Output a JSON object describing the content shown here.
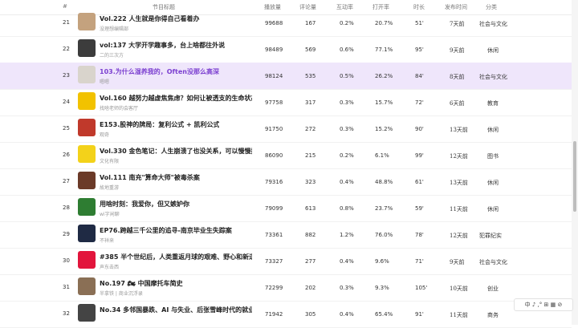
{
  "header": {
    "rank": "#",
    "title": "节目标题",
    "plays": "播放量",
    "comments": "评论量",
    "interaction": "互动率",
    "open_rate": "打开率",
    "duration": "时长",
    "published": "发布时间",
    "category": "分类"
  },
  "rows": [
    {
      "rank": "21",
      "title": "Vol.222 人生就是你得自己看着办",
      "author": "没理想编辑部",
      "plays": "99688",
      "comments": "167",
      "interaction": "0.2%",
      "open_rate": "20.7%",
      "duration": "51'",
      "published": "7天前",
      "category": "社会与文化",
      "thumb_color": "#c4a27e"
    },
    {
      "rank": "22",
      "title": "vol:137 大学开学趣事多，台上啥都往外说",
      "author": "二的三次方",
      "plays": "98489",
      "comments": "569",
      "interaction": "0.6%",
      "open_rate": "77.1%",
      "duration": "95'",
      "published": "9天前",
      "category": "休闲",
      "thumb_color": "#3c3c3c"
    },
    {
      "rank": "23",
      "title": "103.为什么湿养我的，Often没那么高深",
      "author": "嗯嗯",
      "plays": "98124",
      "comments": "535",
      "interaction": "0.5%",
      "open_rate": "26.2%",
      "duration": "84'",
      "published": "8天前",
      "category": "社会与文化",
      "thumb_color": "#d9d4cc"
    },
    {
      "rank": "24",
      "title": "Vol.160 越努力越虚焦焦虑？如何让被透支的生命状态...",
      "author": "找啥老师的会客厅",
      "plays": "97758",
      "comments": "317",
      "interaction": "0.3%",
      "open_rate": "15.7%",
      "duration": "72'",
      "published": "6天前",
      "category": "教育",
      "thumb_color": "#f2c200"
    },
    {
      "rank": "25",
      "title": "E153.股神的牌局：复利公式 + 凯利公式",
      "author": "观奇",
      "plays": "91750",
      "comments": "272",
      "interaction": "0.3%",
      "open_rate": "15.2%",
      "duration": "90'",
      "published": "13天前",
      "category": "休闲",
      "thumb_color": "#c0392b"
    },
    {
      "rank": "26",
      "title": "Vol.330 金色笔记：人生崩溃了也没关系，可以慢慢拼...",
      "author": "文化有限",
      "plays": "86090",
      "comments": "215",
      "interaction": "0.2%",
      "open_rate": "6.1%",
      "duration": "99'",
      "published": "12天前",
      "category": "图书",
      "thumb_color": "#f3d21a"
    },
    {
      "rank": "27",
      "title": "Vol.111 南充\"算命大师\"被毒杀案",
      "author": "故地重游",
      "plays": "79316",
      "comments": "323",
      "interaction": "0.4%",
      "open_rate": "48.8%",
      "duration": "61'",
      "published": "13天前",
      "category": "休闲",
      "thumb_color": "#6b3a28"
    },
    {
      "rank": "28",
      "title": "用啥时刻：我爱你，但又嫉妒你",
      "author": "wi字闲聊",
      "plays": "79099",
      "comments": "613",
      "interaction": "0.8%",
      "open_rate": "23.7%",
      "duration": "59'",
      "published": "11天前",
      "category": "休闲",
      "thumb_color": "#2e7d32"
    },
    {
      "rank": "29",
      "title": "EP76.跨越三千公里的追寻-南京毕业生失踪案",
      "author": "不祥来",
      "plays": "73361",
      "comments": "882",
      "interaction": "1.2%",
      "open_rate": "76.0%",
      "duration": "78'",
      "published": "12天前",
      "category": "犯罪纪实",
      "thumb_color": "#1f2a44"
    },
    {
      "rank": "30",
      "title": "#385 半个世纪后，人类重返月球的艰难、野心和新逻辑",
      "author": "声东击西",
      "plays": "73327",
      "comments": "277",
      "interaction": "0.4%",
      "open_rate": "9.6%",
      "duration": "71'",
      "published": "9天前",
      "category": "社会与文化",
      "thumb_color": "#e2153c"
    },
    {
      "rank": "31",
      "title": "No.197 🏍 中国摩托车简史",
      "author": "半拿铁 | 商业沉浮录",
      "plays": "72299",
      "comments": "202",
      "interaction": "0.3%",
      "open_rate": "9.3%",
      "duration": "105'",
      "published": "10天前",
      "category": "创业",
      "thumb_color": "#8a6f55"
    },
    {
      "rank": "32",
      "title": "No.34 多邻国暴跌、AI 与失业、后张雪峰时代的就业...",
      "author": "",
      "plays": "71942",
      "comments": "305",
      "interaction": "0.4%",
      "open_rate": "65.4%",
      "duration": "91'",
      "published": "11天前",
      "category": "商务",
      "thumb_color": "#444444"
    }
  ],
  "ime": {
    "label": "中 ♪ ,° ⊞ ▦ ⊘"
  }
}
